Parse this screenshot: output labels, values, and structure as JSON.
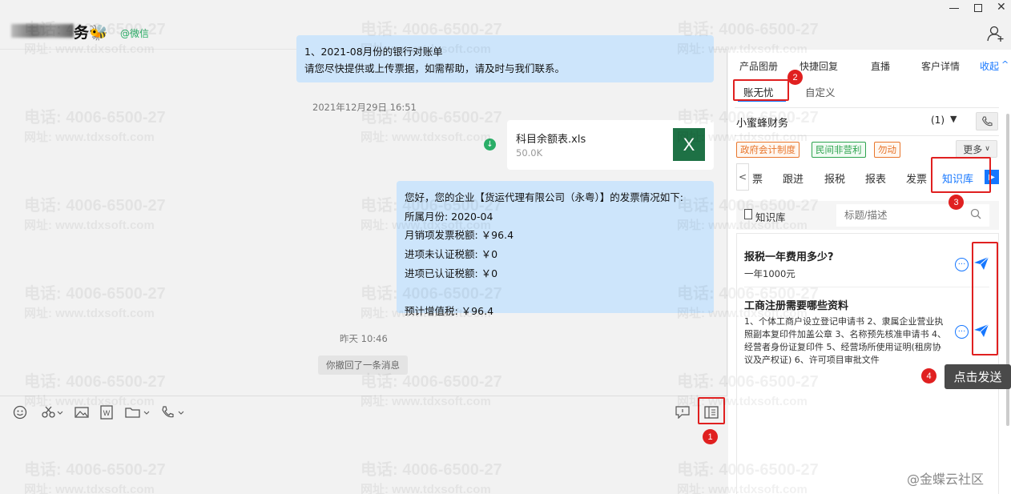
{
  "window": {
    "min_icon": "minimize-icon",
    "max_icon": "maximize-icon",
    "close_icon": "close-icon"
  },
  "chat_header": {
    "name": "务🐝",
    "source": "@微信"
  },
  "messages": {
    "bubble1_line1": "1、2021-08月份的银行对账单",
    "bubble1_line2": "请您尽快提供或上传票据，如需帮助，请及时与我们联系。",
    "time1": "2021年12月29日 16:51",
    "file_name": "科目余额表.xls",
    "file_size": "50.0K",
    "file_icon_letter": "X",
    "bubble2_lines": [
      "您好，您的企业【货运代理有限公司（永粤）】的发票情况如下:",
      "所属月份: 2020-04",
      "月销项发票税额: ￥96.4",
      "进项未认证税额: ￥0",
      "进项已认证税额: ￥0",
      "",
      "预计增值税: ￥96.4"
    ],
    "time2": "昨天 10:46",
    "recall_notice": "你撤回了一条消息"
  },
  "right_panel": {
    "tabs": [
      "产品图册",
      "快捷回复",
      "直播",
      "客户详情"
    ],
    "collapse_label": "收起",
    "sub_tabs": [
      "账无忧",
      "自定义"
    ],
    "company_name": "小蜜蜂财务",
    "company_count": "(1)",
    "tags": [
      {
        "label": "政府会计制度",
        "color": "#e8762c"
      },
      {
        "label": "民间非营利",
        "color": "#2ea44f"
      },
      {
        "label": "勿动",
        "color": "#e8762c"
      }
    ],
    "more_label": "更多",
    "nav_prev": "<",
    "nav_items": [
      "票",
      "跟进",
      "报税",
      "报表",
      "发票",
      "知识库"
    ],
    "kb_label": "知识库",
    "search_placeholder": "标题/描述",
    "cards": [
      {
        "title": "报税一年费用多少?",
        "body": "一年1000元"
      },
      {
        "title": "工商注册需要哪些资料",
        "body": "1、个体工商户设立登记申请书 2、隶属企业营业执照副本复印件加盖公章 3、名称预先核准申请书 4、经营者身份证复印件 5、经营场所使用证明(租房协议及产权证) 6、许可项目审批文件"
      }
    ],
    "tooltip": "点击发送"
  },
  "annotations": {
    "n1": "1",
    "n2": "2",
    "n3": "3",
    "n4": "4"
  },
  "watermark": {
    "phone": "电话: 4006-6500-27",
    "site": "网址: www.tdxsoft.com",
    "brand": "@金蝶云社区"
  },
  "colors": {
    "accent": "#1677ff",
    "bubble": "#cde5fb",
    "annotation_red": "#e02020",
    "excel_green": "#1e7145"
  }
}
